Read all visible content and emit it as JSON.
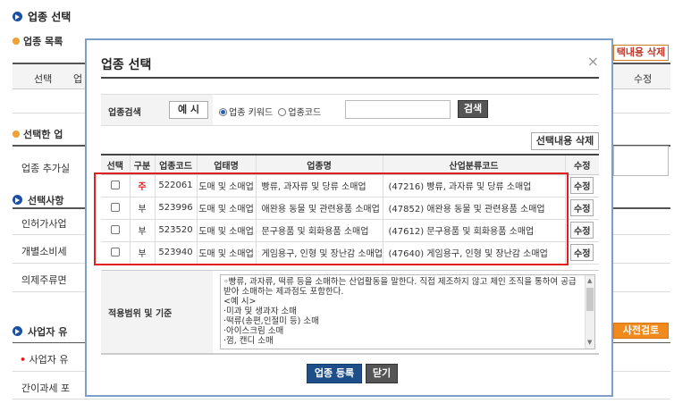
{
  "page": {
    "title": "업종 선택",
    "list_section": "업종 목록",
    "list_delete_btn": "택내용 삭제",
    "list_cols": [
      "선택",
      "업",
      "수정"
    ],
    "selected_section": "선택한 업",
    "add_label": "업종 추가실",
    "options_section": "선택사항",
    "opt1": "인허가사업",
    "opt2": "개별소비세",
    "opt3": "의제주류면",
    "business_section": "사업자 유",
    "precheck_btn": "사전검토",
    "bullet_item": "사업자 유",
    "simple_tax": "간이과세 포"
  },
  "modal": {
    "title": "업종 선택",
    "close_icon": "×",
    "search_label": "업종검색",
    "example_btn": "예 시",
    "radio_keyword": "업종 키워드",
    "radio_code": "업종코드",
    "search_value": "",
    "search_btn": "검색",
    "delete_btn": "선택내용 삭제",
    "columns": [
      "선택",
      "구분",
      "업종코드",
      "업태명",
      "업종명",
      "산업분류코드",
      "수정"
    ],
    "rows": [
      {
        "type": "주",
        "code": "522061",
        "biz": "도매 및 소매업",
        "name": "빵류, 과자류 및 당류 소매업",
        "industry": "(47216) 빵류, 과자류 및 당류 소매업",
        "edit": "수정"
      },
      {
        "type": "부",
        "code": "523996",
        "biz": "도매 및 소매업",
        "name": "애완용 동물 및 관련용품 소매업",
        "industry": "(47852) 애완용 동물 및 관련용품 소매업",
        "edit": "수정"
      },
      {
        "type": "부",
        "code": "523520",
        "biz": "도매 및 소매업",
        "name": "문구용품 및 회화용품 소매업",
        "industry": "(47612) 문구용품 및 회화용품 소매업",
        "edit": "수정"
      },
      {
        "type": "부",
        "code": "523940",
        "biz": "도매 및 소매업",
        "name": "게임용구, 인형 및 장난감 소매업",
        "industry": "(47640) 게임용구, 인형 및 장난감 소매업",
        "edit": "수정"
      }
    ],
    "scope_label": "적용범위 및 기준",
    "scope_lines": [
      "◦빵류, 과자류, 떡류 등을 소매하는 산업활동을 말한다. 직접 제조하지 않고 체인 조직을 통하여 공급",
      "받아 소매하는 제과점도 포함한다.",
      "<예 시>",
      "·미과 및 생과자 소매",
      "·떡류(송편,인절미 등) 소매",
      "·아이스크림 소매",
      "·껌, 캔디 소매"
    ],
    "register_btn": "업종 등록",
    "close_btn": "닫기"
  },
  "colors": {
    "accent": "#1e4fa3",
    "highlight": "#e02020",
    "orange": "#f08a1c",
    "main_tag": "#e02020"
  }
}
